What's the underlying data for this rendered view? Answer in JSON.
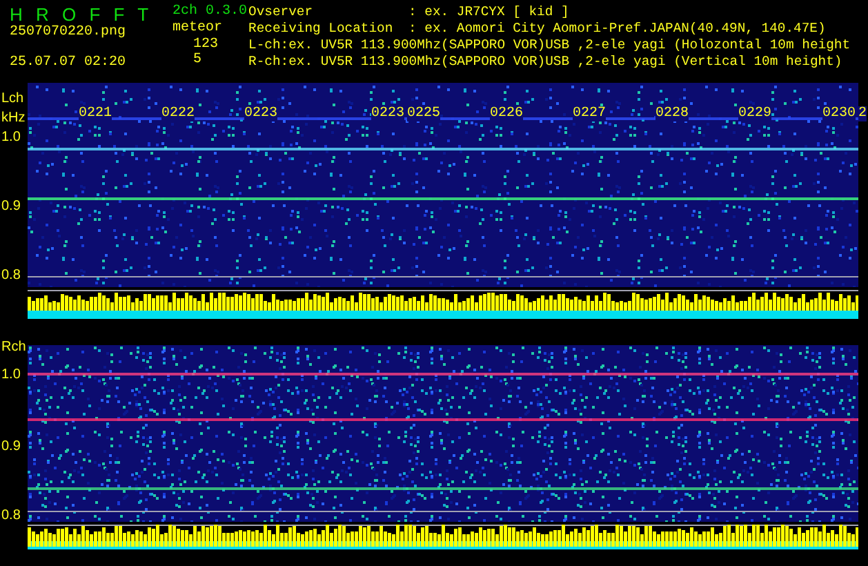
{
  "header": {
    "title": "H R O F F T",
    "version": "2ch 0.3.0",
    "filename": "2507070220.png",
    "mode": "meteor",
    "count": "123",
    "timestamp": "25.07.07 02:20",
    "count_2": "5",
    "info": [
      {
        "label": "Ovserver",
        "value": ": ex. JR7CYX [ kid ]"
      },
      {
        "label": "Receiving Location",
        "value": ": ex. Aomori City Aomori-Pref.JAPAN(40.49N, 140.47E)"
      },
      {
        "label": "L-ch:ex. UV5R 113.900Mhz(SAPPORO VOR)USB ,2-ele yagi (Holozontal 10m height"
      },
      {
        "label": "R-ch:ex. UV5R 113.900Mhz(SAPPORO VOR)USB ,2-ele yagi (Vertical 10m height)"
      }
    ]
  },
  "channels": [
    {
      "label": "Lch",
      "unit": "kHz",
      "time_labels": [
        "0221",
        "0222",
        "0223",
        "0223",
        "0225",
        "0226",
        "0227",
        "0228",
        "0229",
        "0230",
        "2"
      ],
      "ticks": [
        "1.0",
        "0.9",
        "0.8"
      ]
    },
    {
      "label": "Rch",
      "ticks": [
        "1.0",
        "0.9",
        "0.8"
      ]
    }
  ]
}
